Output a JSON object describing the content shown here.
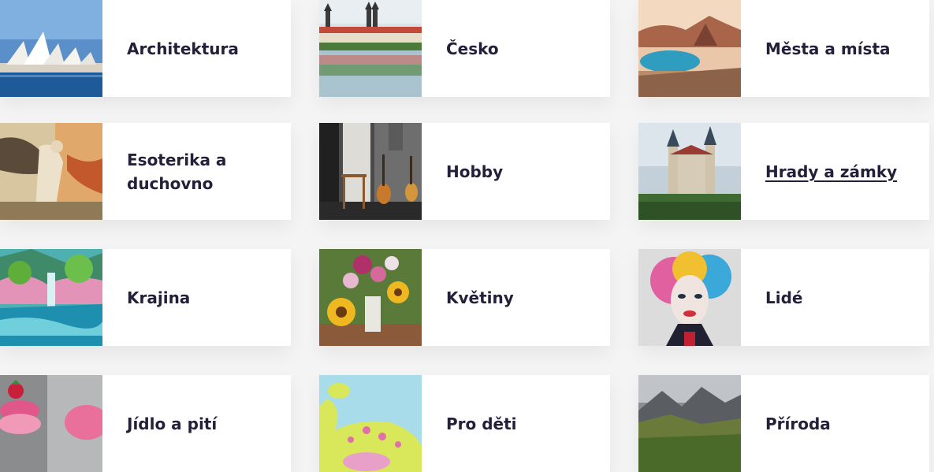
{
  "categories": [
    {
      "label": "Architektura",
      "image": "sydney-opera-house"
    },
    {
      "label": "Česko",
      "image": "czech-town-lake"
    },
    {
      "label": "Města a místa",
      "image": "bay-mountain-city"
    },
    {
      "label": "Esoterika a duchovno",
      "image": "angel-painting"
    },
    {
      "label": "Hobby",
      "image": "guitars-room"
    },
    {
      "label": "Hrady a zámky",
      "image": "castle"
    },
    {
      "label": "Krajina",
      "image": "waterfall-landscape"
    },
    {
      "label": "Květiny",
      "image": "sunflowers-bouquet"
    },
    {
      "label": "Lidé",
      "image": "pop-art-portrait"
    },
    {
      "label": "Jídlo a pití",
      "image": "macarons"
    },
    {
      "label": "Pro děti",
      "image": "dinosaur"
    },
    {
      "label": "Příroda",
      "image": "mountain-valley"
    }
  ],
  "hovered_label": "Hrady a zámky",
  "colors": {
    "text": "#23203a",
    "background": "#f4f4f5",
    "card": "#ffffff"
  }
}
